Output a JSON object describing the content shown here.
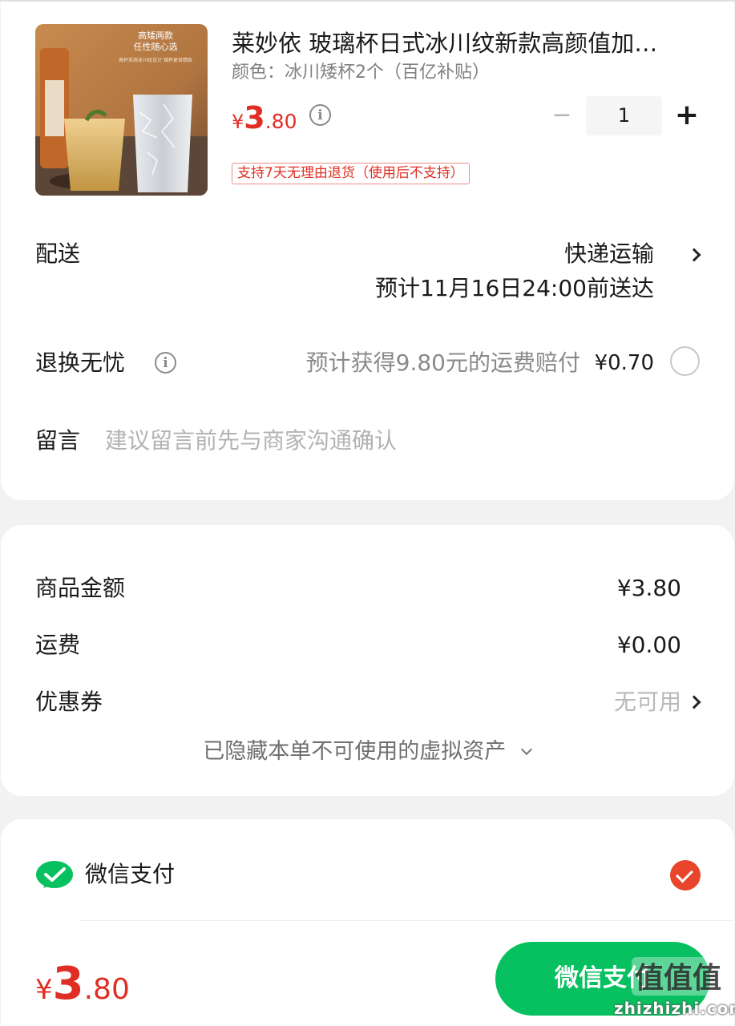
{
  "product": {
    "title": "莱妙依 玻璃杯日式冰川纹新款高颜值加…",
    "spec": "颜色：冰川矮杯2个（百亿补贴）",
    "price_symbol": "¥",
    "price_int": "3",
    "price_dec": ".80",
    "quantity": "1",
    "return_tag": "支持7天无理由退货（使用后不支持）",
    "image_caption_1": "高矮两款",
    "image_caption_2": "任性随心选",
    "image_caption_3": "高杯采用冰川纹设计 矮杯更显精致"
  },
  "delivery": {
    "label": "配送",
    "method": "快递运输",
    "estimate": "预计11月16日24:00前送达"
  },
  "return_insurance": {
    "label": "退换无忧",
    "desc": "预计获得9.80元的运费赔付",
    "price": "¥0.70"
  },
  "message": {
    "label": "留言",
    "placeholder": "建议留言前先与商家沟通确认"
  },
  "summary": {
    "goods_label": "商品金额",
    "goods_value": "¥3.80",
    "shipping_label": "运费",
    "shipping_value": "¥0.00",
    "coupon_label": "优惠券",
    "coupon_value": "无可用",
    "hidden_assets": "已隐藏本单不可使用的虚拟资产"
  },
  "payment": {
    "method": "微信支付",
    "selected": true
  },
  "footer": {
    "total_symbol": "¥",
    "total_int": "3",
    "total_dec": ".80",
    "pay_button": "微信支付"
  },
  "watermark": {
    "text": "值值值",
    "url": "zhizhizhi.com"
  },
  "colors": {
    "price_red": "#e02e24",
    "wechat_green": "#07c160",
    "check_orange": "#e8452c"
  }
}
